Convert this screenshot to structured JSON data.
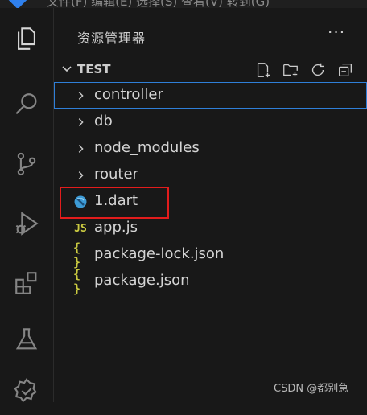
{
  "menubar": {
    "text": "文件(F)  编辑(E)  选择(S)  查看(V)  转到(G)"
  },
  "activity_bar": {
    "items": [
      {
        "name": "explorer-icon"
      },
      {
        "name": "search-icon"
      },
      {
        "name": "source-control-icon"
      },
      {
        "name": "run-debug-icon"
      },
      {
        "name": "extensions-icon"
      },
      {
        "name": "testing-icon"
      },
      {
        "name": "remote-icon"
      }
    ]
  },
  "sidebar": {
    "title": "资源管理器",
    "more": "···",
    "section": {
      "name": "TEST",
      "actions": [
        "new-file-icon",
        "new-folder-icon",
        "refresh-icon",
        "collapse-all-icon"
      ]
    },
    "tree": [
      {
        "label": "controller",
        "type": "folder"
      },
      {
        "label": "db",
        "type": "folder"
      },
      {
        "label": "node_modules",
        "type": "folder"
      },
      {
        "label": "router",
        "type": "folder"
      },
      {
        "label": "1.dart",
        "type": "dart"
      },
      {
        "label": "app.js",
        "type": "js",
        "badge": "JS"
      },
      {
        "label": "package-lock.json",
        "type": "json",
        "badge": "{ }"
      },
      {
        "label": "package.json",
        "type": "json",
        "badge": "{ }"
      }
    ]
  },
  "colors": {
    "accent": "#2f7fd8",
    "annotation": "#e21c1c",
    "js": "#cbcb41",
    "dart": "#3d9bd6"
  },
  "watermark": "CSDN @都别急"
}
